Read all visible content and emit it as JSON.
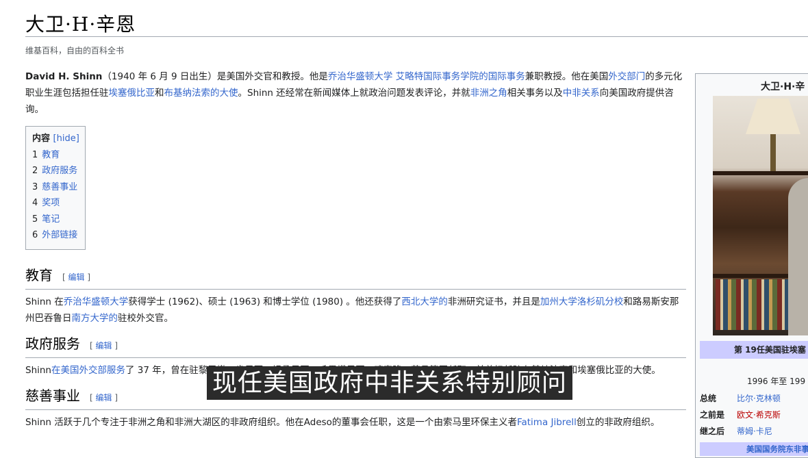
{
  "article": {
    "title": "大卫·H·辛恩",
    "tagline": "维基百科，自由的百科全书",
    "lead": [
      {
        "t": "David H. Shinn",
        "b": true
      },
      {
        "t": "（1940 年 6 月 9 日出生）是美国外交官和教授。他是"
      },
      {
        "t": "乔治华盛顿大学 艾略特国际事务学院的国际事务",
        "link": true
      },
      {
        "t": "兼职教授。他在美国"
      },
      {
        "t": "外交部门",
        "link": true
      },
      {
        "t": "的多元化职业生涯包括担任驻"
      },
      {
        "t": "埃塞俄比亚",
        "link": true
      },
      {
        "t": "和"
      },
      {
        "t": "布基纳法索的大使",
        "link": true
      },
      {
        "t": "。Shinn 还经常在新闻媒体上就政治问题发表评论，并就"
      },
      {
        "t": "非洲之角",
        "link": true
      },
      {
        "t": "相关事务以及"
      },
      {
        "t": "中非关系",
        "link": true
      },
      {
        "t": "向美国政府提供咨询。"
      }
    ]
  },
  "toc": {
    "title": "内容",
    "hide_label": "[hide]",
    "items": [
      {
        "num": "1",
        "label": "教育"
      },
      {
        "num": "2",
        "label": "政府服务"
      },
      {
        "num": "3",
        "label": "慈善事业"
      },
      {
        "num": "4",
        "label": "奖项"
      },
      {
        "num": "5",
        "label": "笔记"
      },
      {
        "num": "6",
        "label": "外部链接"
      }
    ]
  },
  "sections": [
    {
      "heading": "教育",
      "edit": "编辑",
      "body": [
        {
          "t": "Shinn 在"
        },
        {
          "t": "乔治华盛顿大学",
          "link": true
        },
        {
          "t": "获得学士 (1962)、硕士 (1963) 和博士学位 (1980) 。他还获得了"
        },
        {
          "t": "西北大学的",
          "link": true
        },
        {
          "t": "非洲研究证书，并且是"
        },
        {
          "t": "加州大学洛杉矶分校",
          "link": true
        },
        {
          "t": "和路易斯安那州巴吞鲁日"
        },
        {
          "t": "南方大学的",
          "link": true
        },
        {
          "t": "驻校外交官。"
        }
      ]
    },
    {
      "heading": "政府服务",
      "edit": "编辑",
      "body": [
        {
          "t": "Shinn"
        },
        {
          "t": "在美国外交部服务",
          "link": true
        },
        {
          "t": "了 37 年，曾在驻黎巴嫩、肯尼亚、坦桑尼亚、毛里塔尼亚、喀麦隆、苏丹等国任职，并曾担任驻布基纳法索和埃塞俄比亚的大使。"
        }
      ]
    },
    {
      "heading": "慈善事业",
      "edit": "编辑",
      "body": [
        {
          "t": "Shinn 活跃于几个专注于非洲之角和非洲大湖区的非政府组织。他在Adeso的董事会任职，这是一个由索马里环保主义者"
        },
        {
          "t": "Fatima Jibrell",
          "link": true
        },
        {
          "t": "创立的非政府组织。"
        }
      ]
    }
  ],
  "infobox": {
    "title": "大卫·H·辛",
    "caption": "第 19任美国驻埃塞",
    "term": "1996 年至 199",
    "rows": [
      {
        "label": "总统",
        "value": "比尔·克林顿",
        "red": false
      },
      {
        "label": "之前是",
        "value": "欧文·希克斯",
        "red": true
      },
      {
        "label": "继之后",
        "value": "蒂姆·卡尼",
        "red": false
      }
    ],
    "bottom": "美国国务院东非事"
  },
  "video_subtitle": "现任美国政府中非关系特别顾问"
}
